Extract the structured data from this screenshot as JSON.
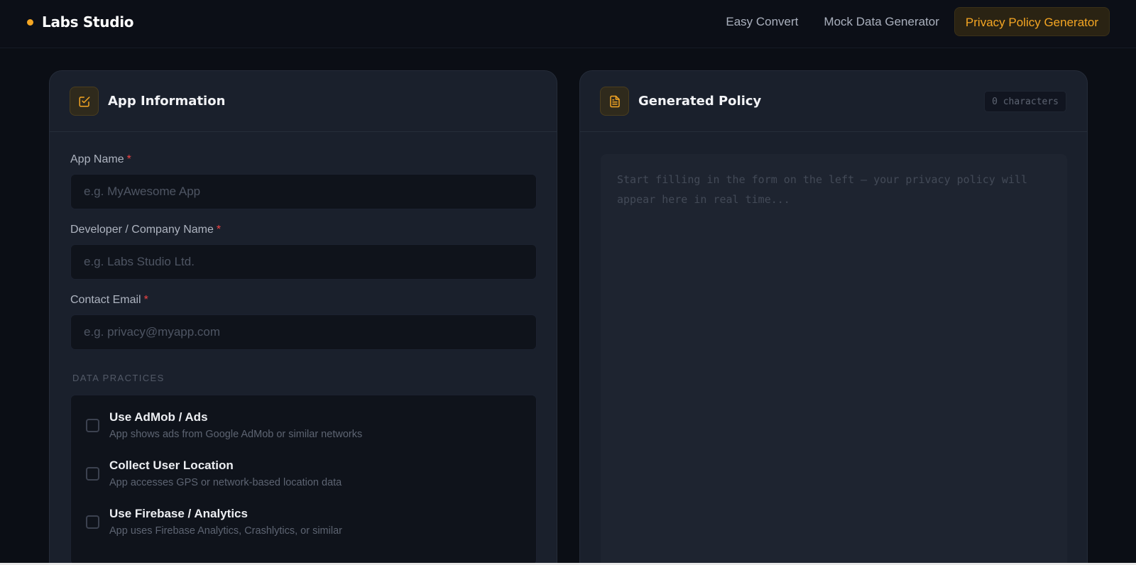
{
  "brand": {
    "name": "Labs Studio"
  },
  "nav": {
    "items": [
      "Easy Convert",
      "Mock Data Generator",
      "Privacy Policy Generator"
    ],
    "active_index": 2
  },
  "app_info": {
    "title": "App Information",
    "icon": "edit-checkbox-icon",
    "fields": [
      {
        "label": "App Name",
        "required_mark": "*",
        "placeholder": "e.g. MyAwesome App",
        "value": ""
      },
      {
        "label": "Developer / Company Name",
        "required_mark": "*",
        "placeholder": "e.g. Labs Studio Ltd.",
        "value": ""
      },
      {
        "label": "Contact Email",
        "required_mark": "*",
        "placeholder": "e.g. privacy@myapp.com",
        "value": ""
      }
    ],
    "section_label": "DATA PRACTICES",
    "practices": [
      {
        "title": "Use AdMob / Ads",
        "desc": "App shows ads from Google AdMob or similar networks",
        "checked": false
      },
      {
        "title": "Collect User Location",
        "desc": "App accesses GPS or network-based location data",
        "checked": false
      },
      {
        "title": "Use Firebase / Analytics",
        "desc": "App uses Firebase Analytics, Crashlytics, or similar",
        "checked": false
      }
    ]
  },
  "policy": {
    "title": "Generated Policy",
    "icon": "document-icon",
    "char_count": "0 characters",
    "placeholder_line1": "Start filling in the form on the left — your privacy policy will",
    "placeholder_line2": "appear here in real time..."
  },
  "colors": {
    "accent": "#f5a623",
    "background": "#0b0e15",
    "panel": "#1a202c",
    "required": "#ef4444"
  }
}
